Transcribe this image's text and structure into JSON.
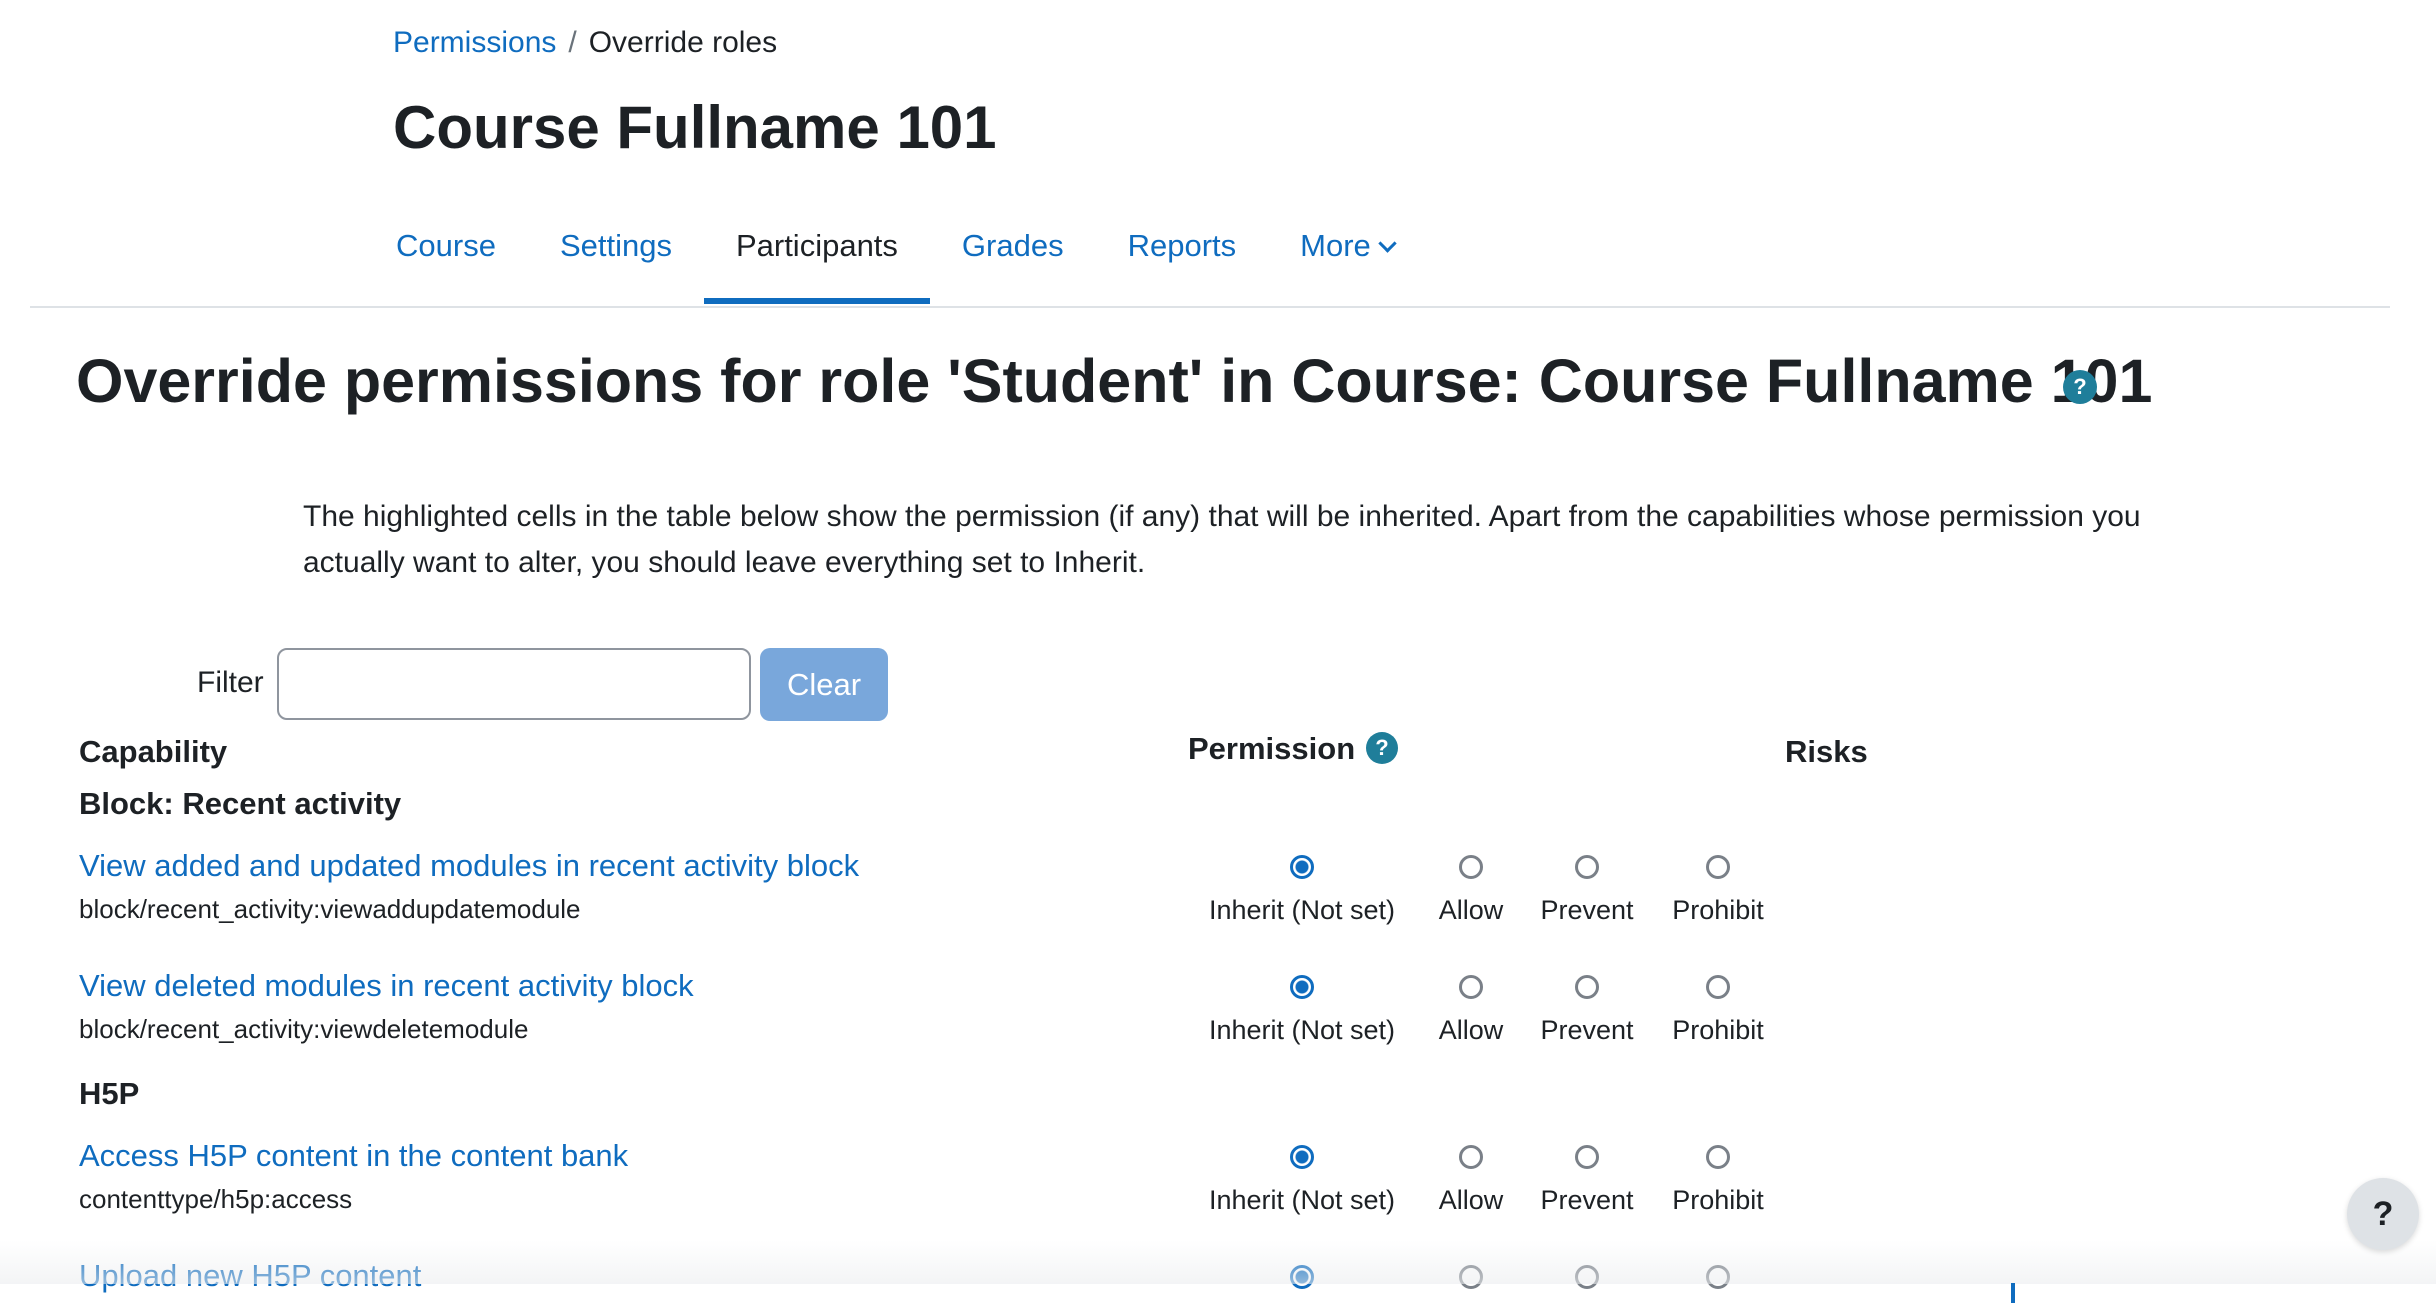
{
  "breadcrumb": {
    "parent": "Permissions",
    "separator": "/",
    "current": "Override roles"
  },
  "course_title": "Course Fullname 101",
  "tabs": [
    {
      "label": "Course"
    },
    {
      "label": "Settings"
    },
    {
      "label": "Participants",
      "active": true
    },
    {
      "label": "Grades"
    },
    {
      "label": "Reports"
    },
    {
      "label": "More"
    }
  ],
  "page_heading": "Override permissions for role 'Student' in Course: Course Fullname 101",
  "intro_text": "The highlighted cells in the table below show the permission (if any) that will be inherited. Apart from the capabilities whose permission you actually want to alter, you should leave everything set to Inherit.",
  "filter": {
    "label": "Filter",
    "value": "",
    "placeholder": "",
    "clear_label": "Clear"
  },
  "table": {
    "col_capability": "Capability",
    "col_permission": "Permission",
    "col_risks": "Risks",
    "sections": [
      {
        "title": "Block: Recent activity"
      },
      {
        "title": "H5P"
      }
    ],
    "options": [
      "Inherit (Not set)",
      "Allow",
      "Prevent",
      "Prohibit"
    ],
    "rows": [
      {
        "name": "View added and updated modules in recent activity block",
        "code": "block/recent_activity:viewaddupdatemodule",
        "selected": "Inherit (Not set)"
      },
      {
        "name": "View deleted modules in recent activity block",
        "code": "block/recent_activity:viewdeletemodule",
        "selected": "Inherit (Not set)"
      },
      {
        "name": "Access H5P content in the content bank",
        "code": "contenttype/h5p:access",
        "selected": "Inherit (Not set)"
      },
      {
        "name": "Upload new H5P content",
        "code": "",
        "selected": "Inherit (Not set)"
      }
    ]
  },
  "help_button": {
    "label": "?"
  },
  "help_icon_glyph": "?",
  "colors": {
    "link": "#0f6cbf",
    "text": "#1d2125",
    "help_icon": "#1f7e9a",
    "clear_button": "#79a7db"
  }
}
